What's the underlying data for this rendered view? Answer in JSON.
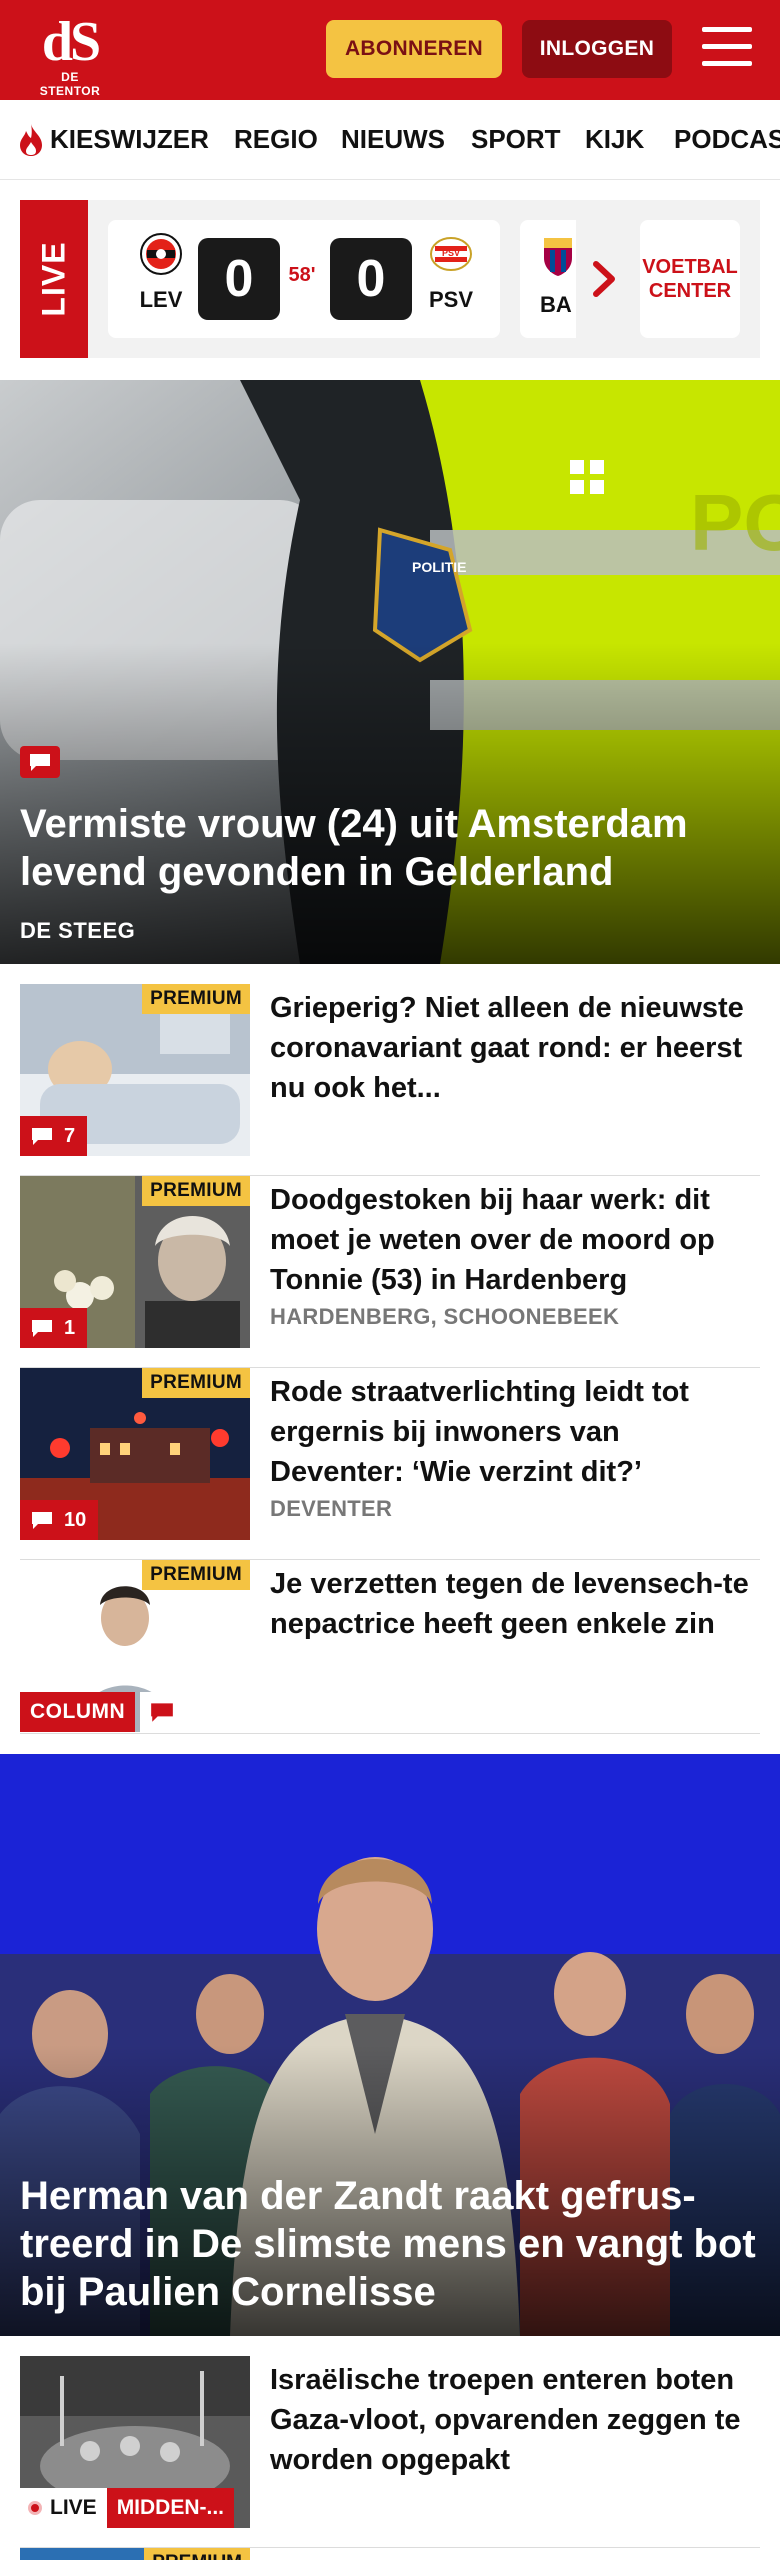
{
  "header": {
    "logo_mark": "dS",
    "logo_name": "DE STENTOR",
    "subscribe_label": "ABONNEREN",
    "login_label": "INLOGGEN"
  },
  "nav": {
    "items": [
      "KIESWIJZER",
      "REGIO",
      "NIEUWS",
      "SPORT",
      "KIJK",
      "PODCAS"
    ]
  },
  "live": {
    "label": "LIVE",
    "match": {
      "home": "LEV",
      "away": "PSV",
      "home_score": "0",
      "away_score": "0",
      "minute": "58'"
    },
    "next_match_home": "BA",
    "voetbal_center_label": "VOETBAL CENTER"
  },
  "hero": {
    "title": "Vermiste vrouw (24) uit Amsterdam levend gevonden in Gelderland",
    "location": "DE STEEG"
  },
  "articles": [
    {
      "badge": "PREMIUM",
      "title": "Grieperig? Niet alleen de nieuwste coronavariant gaat rond: er heerst nu ook het...",
      "comments": "7",
      "location": ""
    },
    {
      "badge": "PREMIUM",
      "title": "Doodgestoken bij haar werk: dit moet je weten over de moord op Tonnie (53) in Hardenberg",
      "comments": "1",
      "location": "HARDENBERG, SCHOONEBEEK"
    },
    {
      "badge": "PREMIUM",
      "title": "Rode straatverlichting leidt tot ergernis bij inwoners van Deventer: ‘Wie verzint dit?’",
      "comments": "10",
      "location": "DEVENTER"
    },
    {
      "badge": "PREMIUM",
      "title": "Je verzetten tegen de levensech-te nepactrice heeft geen enkele zin",
      "tag": "COLUMN"
    }
  ],
  "hero2": {
    "title": "Herman van der Zandt raakt gefrus-treerd in De slimste mens en vangt bot bij Paulien Cornelisse"
  },
  "article_live": {
    "title": "Israëlische troepen enteren boten Gaza-vloot, opvarenden zeggen te worden opgepakt",
    "live_label": "LIVE",
    "region_label": "MIDDEN-..."
  },
  "article_partial": {
    "badge": "PREMIUM"
  },
  "colors": {
    "brand_red": "#cc1119",
    "premium_yellow": "#f4c342",
    "login_dark_red": "#8d0c12"
  }
}
